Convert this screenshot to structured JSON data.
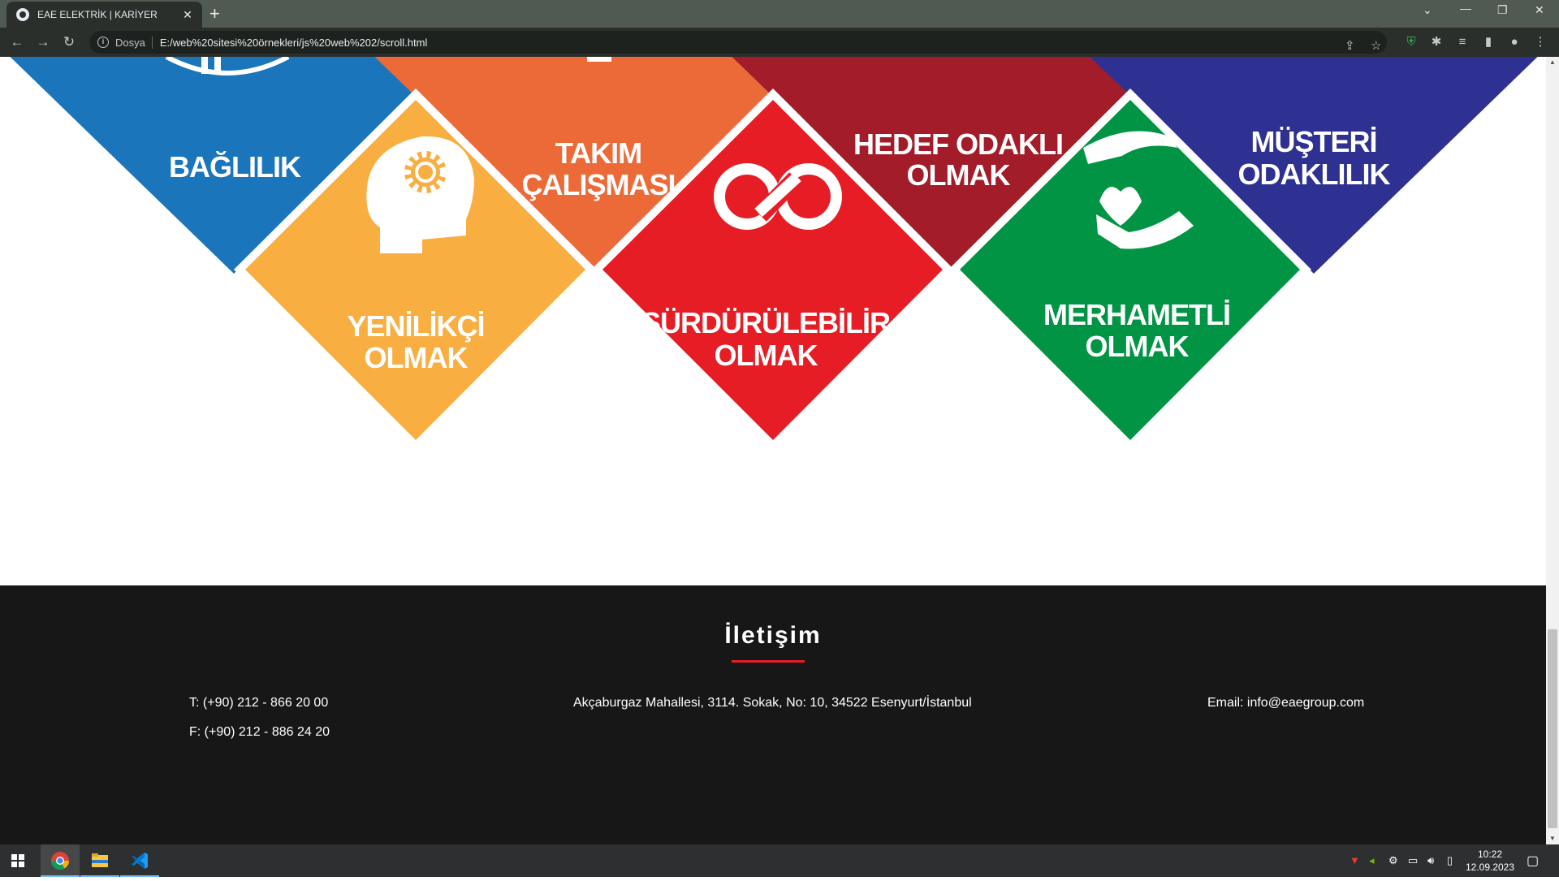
{
  "browser": {
    "tab_title": "EAE ELEKTRİK | KARİYER",
    "tab_close": "✕",
    "new_tab": "+",
    "address_prefix": "Dosya",
    "url": "E:/web%20sitesi%20örnekleri/js%20web%202/scroll.html"
  },
  "values": [
    {
      "label_lines": [
        "BAĞLILIK"
      ],
      "color": "#1b75bb"
    },
    {
      "label_lines": [
        "TAKIM",
        "ÇALIŞMASI"
      ],
      "color": "#ec6a37"
    },
    {
      "label_lines": [
        "HEDEF ODAKLI",
        "OLMAK"
      ],
      "color": "#a21d29"
    },
    {
      "label_lines": [
        "MÜŞTERİ",
        "ODAKLILIK"
      ],
      "color": "#2e3191"
    },
    {
      "label_lines": [
        "YENİLİKÇİ",
        "OLMAK"
      ],
      "color": "#f9ae42",
      "icon": "head-gear-icon"
    },
    {
      "label_lines": [
        "SÜRDÜRÜLEBİLİR",
        "OLMAK"
      ],
      "color": "#e61d25",
      "icon": "infinity-loop-icon"
    },
    {
      "label_lines": [
        "MERHAMETLİ",
        "OLMAK"
      ],
      "color": "#009444",
      "icon": "hands-heart-icon"
    }
  ],
  "footer": {
    "title": "İletişim",
    "phone": "T: (+90) 212 - 866 20 00",
    "fax": "F: (+90) 212 - 886 24 20",
    "address": "Akçaburgaz Mahallesi, 3114. Sokak, No: 10, 34522 Esenyurt/İstanbul",
    "email": "Email: info@eaegroup.com",
    "accent_color": "#e31e24"
  },
  "taskbar": {
    "time": "10:22",
    "date": "12.09.2023"
  }
}
